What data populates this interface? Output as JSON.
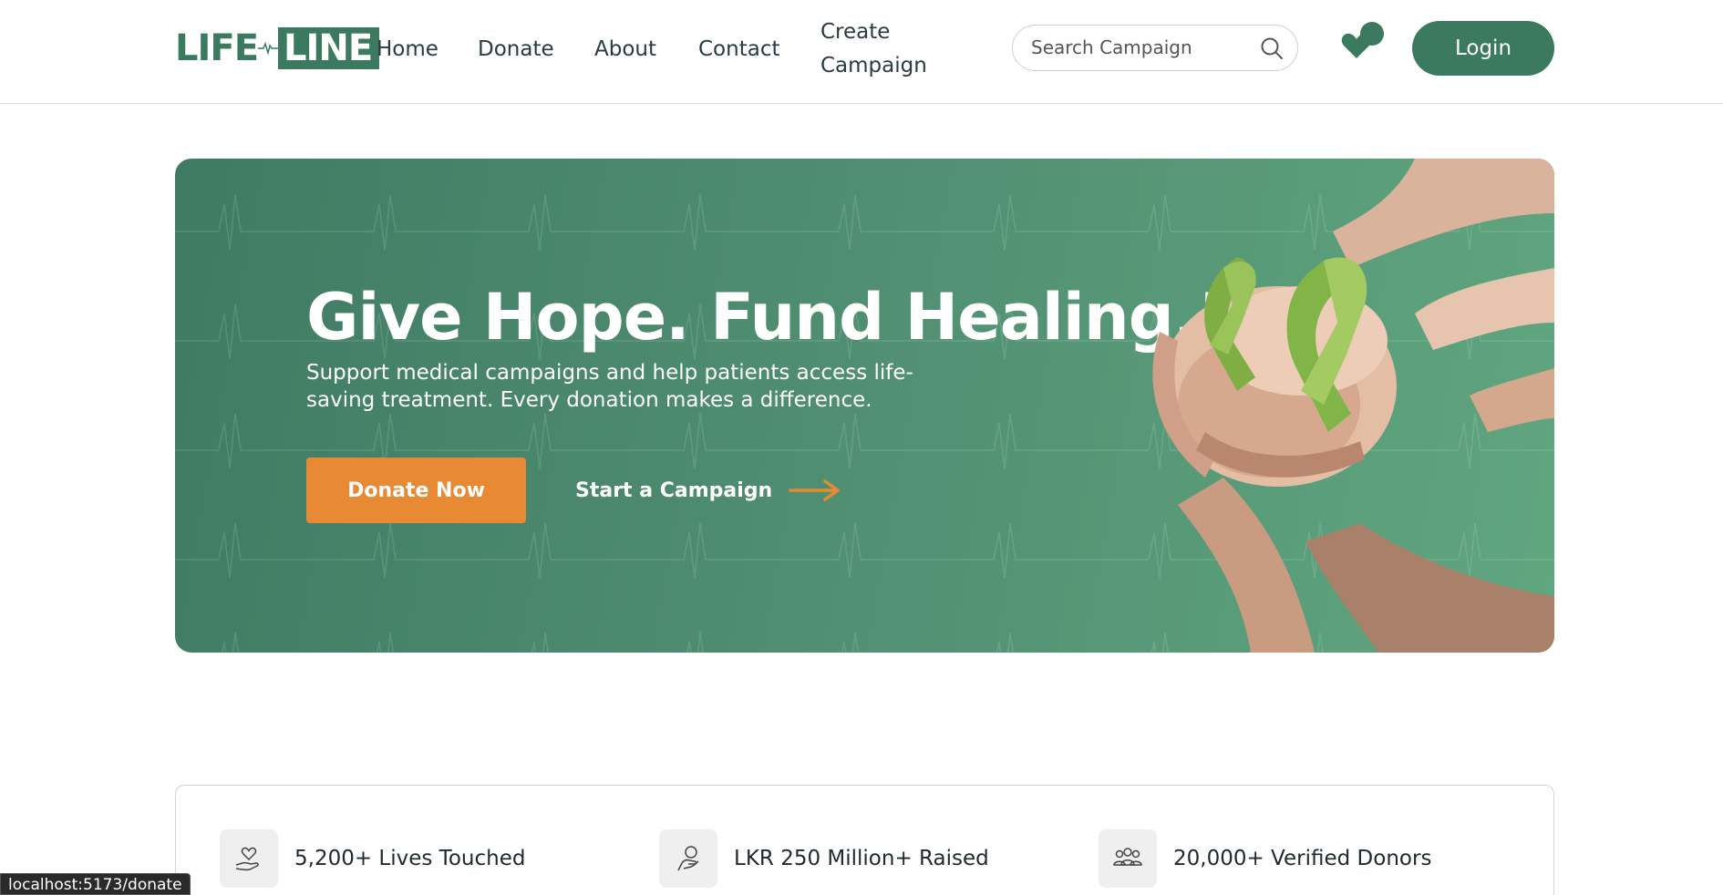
{
  "brand": {
    "part1": "LIFE",
    "part2": "LINE",
    "color": "#3b7a5e"
  },
  "nav": {
    "home": "Home",
    "donate": "Donate",
    "about": "About",
    "contact": "Contact",
    "create_campaign": "Create Campaign"
  },
  "search": {
    "placeholder": "Search Campaign",
    "icon": "search-icon"
  },
  "favorites": {
    "icon": "heart-icon"
  },
  "login": {
    "label": "Login"
  },
  "hero": {
    "title": "Give Hope. Fund Healing.!",
    "subtitle": "Support medical campaigns and help patients access life-saving treatment. Every donation makes a difference.",
    "donate_button": "Donate Now",
    "campaign_link": "Start a Campaign",
    "image": "hands-holding-green-ribbons"
  },
  "stats": [
    {
      "icon": "heart-hand-icon",
      "label": "5,200+ Lives Touched"
    },
    {
      "icon": "coin-hand-icon",
      "label": "LKR 250 Million+ Raised"
    },
    {
      "icon": "people-group-icon",
      "label": "20,000+ Verified Donors"
    }
  ],
  "status_bar": {
    "url": "localhost:5173/donate"
  },
  "colors": {
    "primary": "#3b7a5e",
    "accent": "#e78a33",
    "hero_start": "#3f7b63",
    "hero_end": "#60a67f"
  }
}
